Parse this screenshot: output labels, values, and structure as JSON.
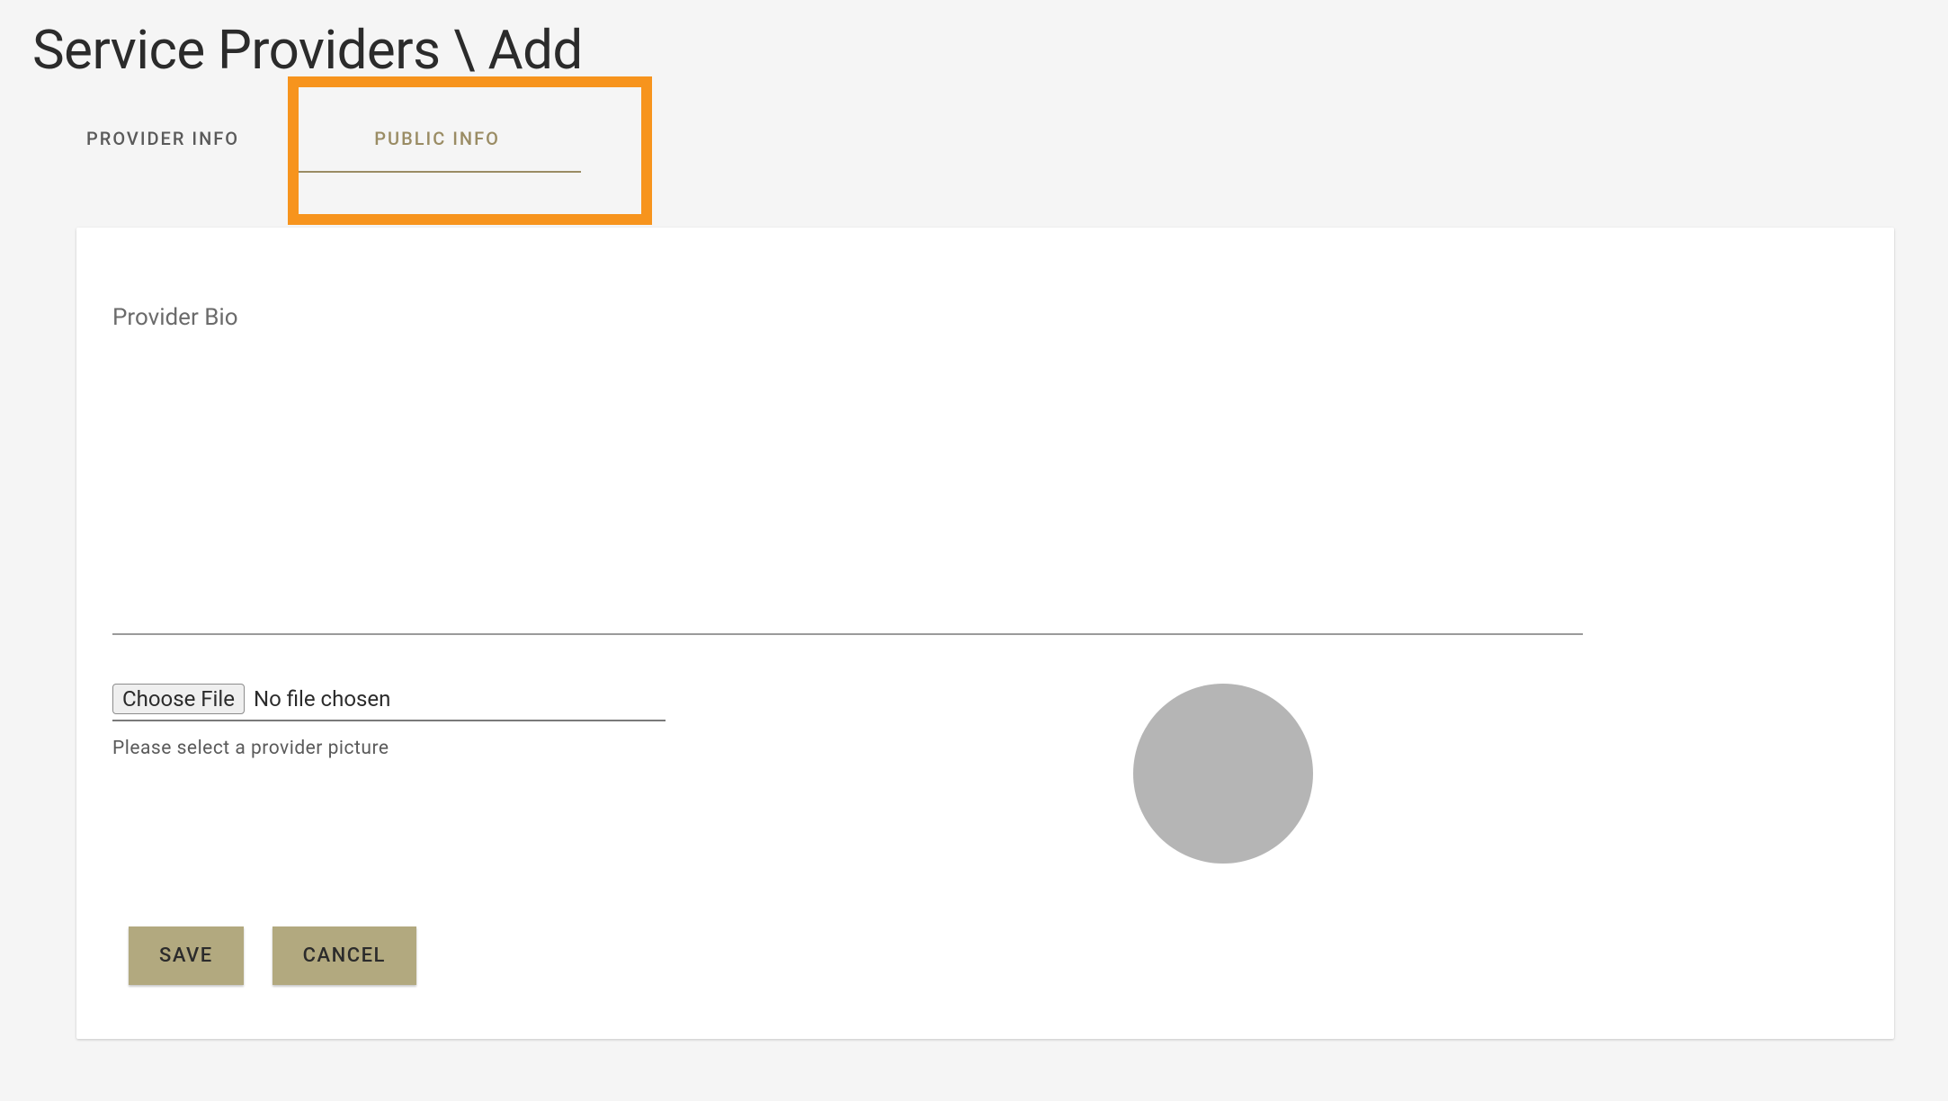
{
  "page": {
    "title": "Service Providers \\ Add"
  },
  "tabs": {
    "provider_info": "PROVIDER INFO",
    "public_info": "PUBLIC INFO"
  },
  "form": {
    "bio_label": "Provider Bio",
    "bio_value": "",
    "file_button": "Choose File",
    "file_status": "No file chosen",
    "file_hint": "Please select a provider picture"
  },
  "buttons": {
    "save": "SAVE",
    "cancel": "CANCEL"
  }
}
